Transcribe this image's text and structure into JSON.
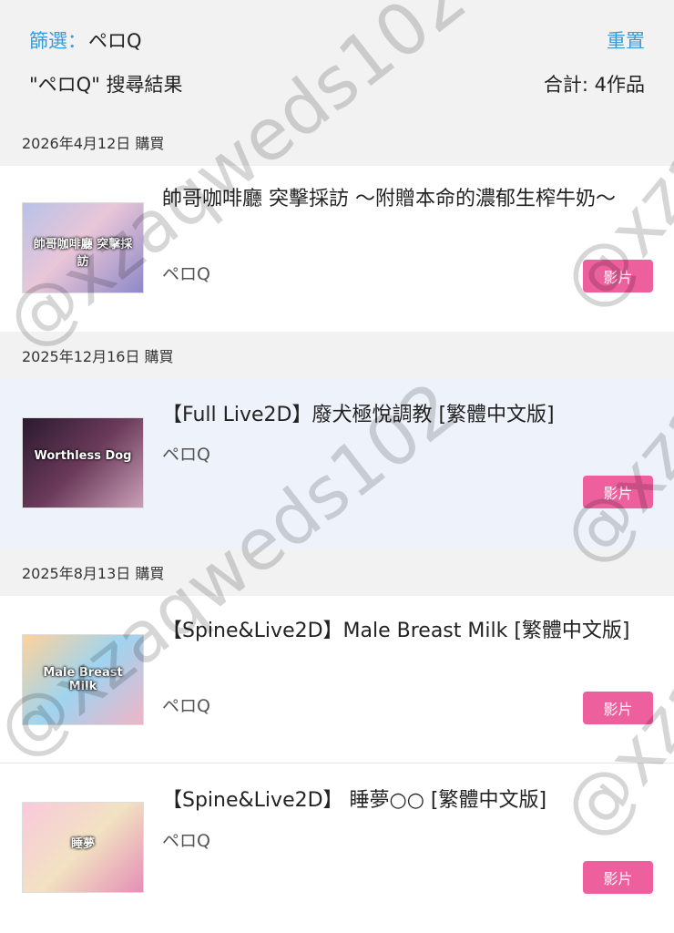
{
  "filter": {
    "label": "篩選：",
    "value": "ペロQ",
    "reset_label": "重置"
  },
  "results": {
    "query_label": "\"ペロQ\" 搜尋結果",
    "total_label": "合計: 4作品"
  },
  "groups": [
    {
      "date_label": "2026年4月12日 購買"
    },
    {
      "date_label": "2025年12月16日 購買"
    },
    {
      "date_label": "2025年8月13日 購買"
    }
  ],
  "items": [
    {
      "title": "帥哥咖啡廳 突擊採訪 〜附贈本命的濃郁生榨牛奶〜",
      "author": "ペロQ",
      "badge": "影片",
      "thumb_text": "帥哥咖啡廳 突擊採訪"
    },
    {
      "title": "【Full Live2D】廢犬極悅調教 [繁體中文版]",
      "author": "ペロQ",
      "badge": "影片",
      "thumb_text": "Worthless Dog"
    },
    {
      "title": "【Spine&Live2D】Male Breast Milk [繁體中文版]",
      "author": "ペロQ",
      "badge": "影片",
      "thumb_text": "Male Breast Milk"
    },
    {
      "title": "【Spine&Live2D】 睡夢○○ [繁體中文版]",
      "author": "ペロQ",
      "badge": "影片",
      "thumb_text": "睡夢"
    }
  ],
  "watermark": "@xzaqweds102",
  "colors": {
    "accent_blue": "#3a9bd8",
    "badge_pink": "#ee5f9e",
    "highlight_row": "#eef3fb",
    "page_bg": "#f2f2f2"
  }
}
